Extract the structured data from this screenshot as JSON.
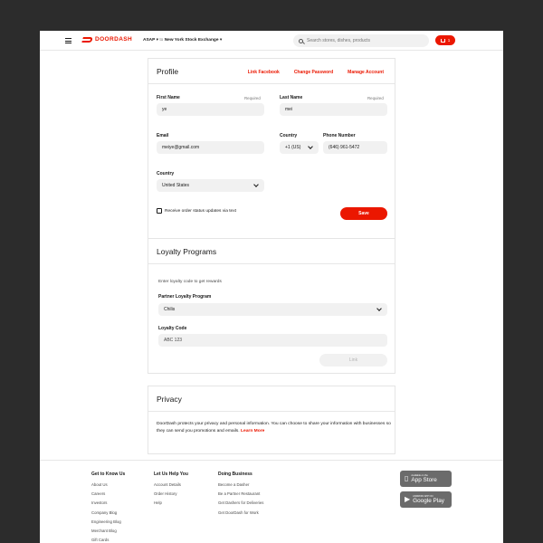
{
  "nav": {
    "brand": "DOORDASH",
    "asap": "ASAP",
    "address_prefix": "to",
    "address": "New York Stock Exchange",
    "search_placeholder": "Search stores, dishes, products",
    "cart_count": "1"
  },
  "profile": {
    "title": "Profile",
    "links": [
      "Link Facebook",
      "Change Password",
      "Manage Account"
    ],
    "first_name_label": "First Name",
    "first_name_required": "Required",
    "first_name_value": "ye",
    "last_name_label": "Last Name",
    "last_name_required": "Required",
    "last_name_value": "mei",
    "email_label": "Email",
    "email_value": "meiye@gmail.com",
    "country_code_label": "Country",
    "country_code_value": "+1 (US)",
    "phone_label": "Phone Number",
    "phone_value": "(646) 961-5472",
    "country_label": "Country",
    "country_value": "United States",
    "sms_checkbox_label": "Receive order status updates via text",
    "save_label": "Save"
  },
  "loyalty": {
    "title": "Loyalty Programs",
    "intro": "Enter loyalty code to get rewards",
    "partner_label": "Partner Loyalty Program",
    "partner_value": "Chilis",
    "code_label": "Loyalty Code",
    "code_placeholder": "ABC 123",
    "link_label": "Link"
  },
  "privacy": {
    "title": "Privacy",
    "text": "DoorDash protects your privacy and personal information. You can choose to share your information with businesses so they can send you promotions and emails.",
    "learn_more": "Learn More"
  },
  "footer": {
    "col1": {
      "title": "Get to Know Us",
      "items": [
        "About Us",
        "Careers",
        "Investors",
        "Company Blog",
        "Engineering Blog",
        "Merchant Blog",
        "Gift Cards"
      ]
    },
    "col2": {
      "title": "Let Us Help You",
      "items": [
        "Account Details",
        "Order History",
        "Help"
      ]
    },
    "col3": {
      "title": "Doing Business",
      "items": [
        "Become a Dasher",
        "Be a Partner Restaurant",
        "Get Dashers for Deliveries",
        "Get DoorDash for Work"
      ]
    },
    "app_store_small": "Available on the",
    "app_store": "App Store",
    "google_play_small": "ANDROID APP ON",
    "google_play": "Google Play"
  },
  "colors": {
    "brand_red": "#eb1700",
    "field_bg": "#f1f1f1",
    "frame_bg": "#2c2c2c"
  }
}
